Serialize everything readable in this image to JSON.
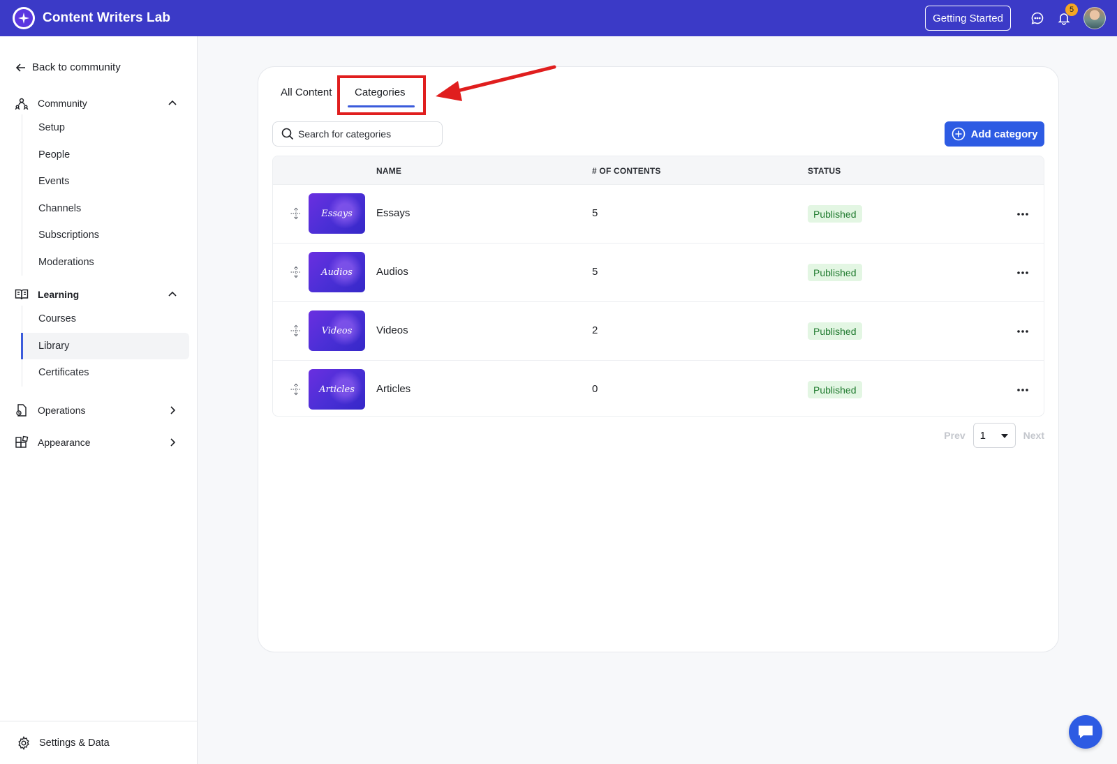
{
  "header": {
    "brand_title": "Content Writers Lab",
    "getting_started_label": "Getting Started",
    "notification_count": "5",
    "bg_color": "#3b3ac7"
  },
  "sidebar": {
    "back_label": "Back to community",
    "sections": [
      {
        "label": "Community",
        "icon": "community-icon",
        "expanded": true,
        "items": [
          {
            "label": "Setup"
          },
          {
            "label": "People"
          },
          {
            "label": "Events"
          },
          {
            "label": "Channels"
          },
          {
            "label": "Subscriptions"
          },
          {
            "label": "Moderations"
          }
        ]
      },
      {
        "label": "Learning",
        "icon": "book-icon",
        "expanded": true,
        "items": [
          {
            "label": "Courses"
          },
          {
            "label": "Library",
            "active": true
          },
          {
            "label": "Certificates"
          }
        ]
      },
      {
        "label": "Operations",
        "icon": "operations-icon",
        "expanded": false
      },
      {
        "label": "Appearance",
        "icon": "appearance-icon",
        "expanded": false
      }
    ],
    "settings_label": "Settings & Data"
  },
  "main": {
    "tabs": [
      {
        "label": "All Content"
      },
      {
        "label": "Categories",
        "active": true
      }
    ],
    "search": {
      "placeholder": "Search for categories",
      "value": ""
    },
    "add_button_label": "Add category",
    "columns": [
      "NAME",
      "# OF CONTENTS",
      "STATUS"
    ],
    "rows": [
      {
        "thumb_text": "Essays",
        "name": "Essays",
        "count": "5",
        "status": "Published"
      },
      {
        "thumb_text": "Audios",
        "name": "Audios",
        "count": "5",
        "status": "Published"
      },
      {
        "thumb_text": "Videos",
        "name": "Videos",
        "count": "2",
        "status": "Published"
      },
      {
        "thumb_text": "Articles",
        "name": "Articles",
        "count": "0",
        "status": "Published"
      }
    ],
    "pagination": {
      "prev_label": "Prev",
      "page": "1",
      "next_label": "Next"
    }
  },
  "annotations": {
    "highlight_color": "#e01e1e"
  }
}
